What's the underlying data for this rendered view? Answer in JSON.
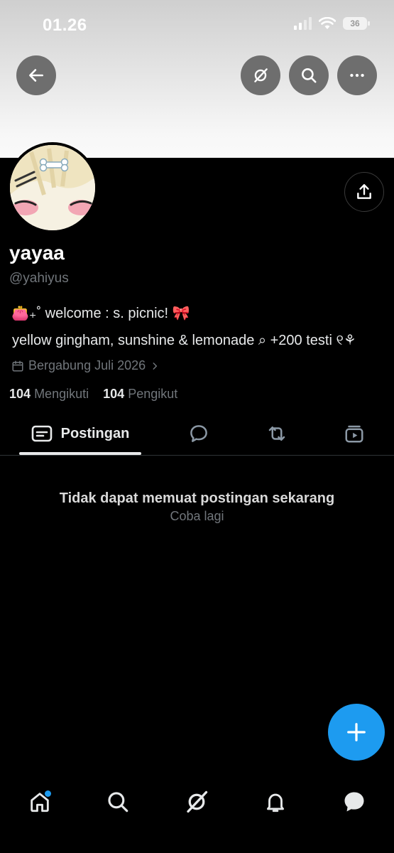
{
  "status_bar": {
    "time": "01.26",
    "battery": "36"
  },
  "profile": {
    "name": "yayaa",
    "handle": "@yahiyus",
    "bio_line1": "👛₊˚ welcome : s. picnic! 🎀",
    "bio_line2": "yellow gingham, sunshine & lemonade ⌕ +200 testi ୧⚘",
    "joined": "Bergabung Juli 2026",
    "following_count": "104",
    "following_label": "Mengikuti",
    "followers_count": "104",
    "followers_label": "Pengikut"
  },
  "tabs": {
    "posts": "Postingan",
    "active": "posts"
  },
  "error": {
    "title": "Tidak dapat memuat postingan sekarang",
    "retry": "Coba lagi"
  },
  "colors": {
    "accent": "#1d9bf0",
    "background": "#000000",
    "muted": "#71767b"
  },
  "icons": {
    "header": [
      "back-arrow-icon",
      "grok-icon",
      "search-icon",
      "more-icon"
    ],
    "share": "share-icon",
    "tabs": [
      "posts-icon",
      "replies-icon",
      "repost-icon",
      "media-icon"
    ],
    "nav": [
      "home-icon",
      "search-icon",
      "grok-icon",
      "bell-icon",
      "messages-icon"
    ]
  }
}
